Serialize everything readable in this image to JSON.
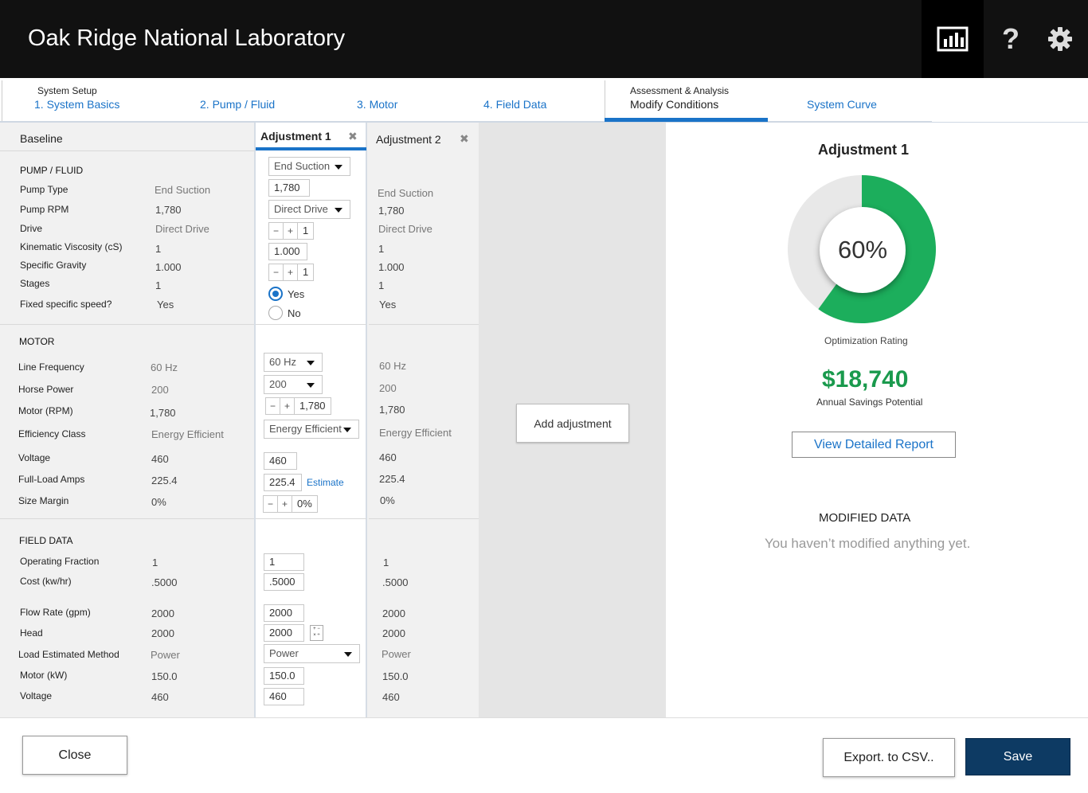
{
  "header": {
    "title": "Oak Ridge National Laboratory",
    "icons": [
      "bar-chart-icon",
      "help-icon",
      "gear-icon"
    ]
  },
  "tabs": {
    "setup_group": "System Setup",
    "analysis_group": "Assessment & Analysis",
    "items": [
      "1. System Basics",
      "2. Pump / Fluid",
      "3. Motor",
      "4. Field Data",
      "Modify Conditions",
      "System Curve"
    ]
  },
  "columns": {
    "baseline": "Baseline",
    "adj1": "Adjustment 1",
    "adj2": "Adjustment 2",
    "close_glyph": "✖"
  },
  "pump": {
    "title": "PUMP / FLUID",
    "labels": [
      "Pump Type",
      "Pump RPM",
      "Drive",
      "Kinematic Viscosity (cS)",
      "Specific Gravity",
      "Stages",
      "Fixed specific speed?"
    ],
    "baseline": [
      "End Suction",
      "1,780",
      "Direct Drive",
      "1",
      "1.000",
      "1",
      "Yes"
    ],
    "adj1": {
      "pump_type": "End Suction",
      "rpm": "1,780",
      "drive": "Direct Drive",
      "viscosity": "1",
      "gravity": "1.000",
      "stages": "1",
      "yes": "Yes",
      "no": "No"
    },
    "adj2": [
      "End Suction",
      "1,780",
      "Direct Drive",
      "1",
      "1.000",
      "1",
      "Yes"
    ]
  },
  "motor": {
    "title": "MOTOR",
    "labels": [
      "Line Frequency",
      "Horse Power",
      "Motor (RPM)",
      "Efficiency Class",
      "Voltage",
      "Full-Load Amps",
      "Size Margin"
    ],
    "baseline": [
      "60 Hz",
      "200",
      "1,780",
      "Energy Efficient",
      "460",
      "225.4",
      "0%"
    ],
    "adj1": {
      "frequency": "60 Hz",
      "horsepower": "200",
      "rpm": "1,780",
      "efficiency": "Energy Efficient",
      "voltage": "460",
      "fla": "225.4",
      "estimate": "Estimate",
      "margin": "0%"
    },
    "adj2": [
      "60 Hz",
      "200",
      "1,780",
      "Energy Efficient",
      "460",
      "225.4",
      "0%"
    ]
  },
  "field": {
    "title": "FIELD DATA",
    "labels": [
      "Operating Fraction",
      "Cost (kw/hr)",
      "Flow Rate (gpm)",
      "Head",
      "Load Estimated Method",
      "Motor (kW)",
      "Voltage"
    ],
    "baseline": [
      "1",
      ".5000",
      "2000",
      "2000",
      "Power",
      "150.0",
      "460"
    ],
    "adj1": {
      "fraction": "1",
      "cost": ".5000",
      "flow": "2000",
      "head": "2000",
      "method": "Power",
      "motor_kw": "150.0",
      "voltage": "460"
    },
    "adj2": [
      "1",
      ".5000",
      "2000",
      "2000",
      "Power",
      "150.0",
      "460"
    ]
  },
  "stepper": {
    "minus": "−",
    "plus": "+"
  },
  "add_adjustment": "Add adjustment",
  "summary": {
    "title": "Adjustment 1",
    "rating_percent": 60,
    "rating_text": "60%",
    "rating_label": "Optimization Rating",
    "savings": "$18,740",
    "savings_label": "Annual Savings Potential",
    "report_button": "View Detailed Report",
    "modified_title": "MODIFIED DATA",
    "modified_empty": "You haven’t modified anything yet.",
    "colors": {
      "rating_fill": "#1cae5c",
      "rating_track": "#e8e8e8",
      "savings": "#1a9a4d"
    }
  },
  "footer": {
    "close": "Close",
    "export": "Export. to CSV..",
    "save": "Save"
  }
}
